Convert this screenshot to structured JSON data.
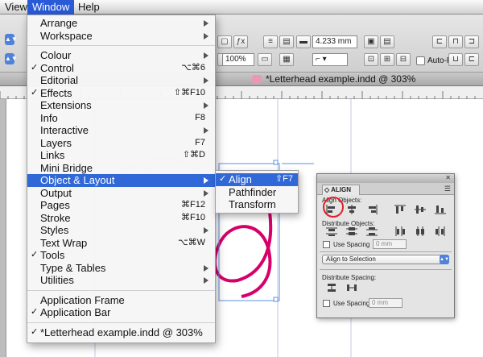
{
  "menubar": {
    "items": [
      {
        "label": "View",
        "active": false
      },
      {
        "label": "Window",
        "active": true
      },
      {
        "label": "Help",
        "active": false
      }
    ]
  },
  "control_bar": {
    "stroke_weight": "4.233 mm",
    "zoom": "100%",
    "autofit_label": "Auto-Fit"
  },
  "document": {
    "title": "*Letterhead example.indd @ 303%"
  },
  "window_menu": {
    "groups": [
      [
        {
          "label": "Arrange",
          "submenu": true
        },
        {
          "label": "Workspace",
          "submenu": true
        }
      ],
      [
        {
          "label": "Colour",
          "submenu": true
        },
        {
          "label": "Control",
          "checked": true,
          "shortcut": "⌥⌘6"
        },
        {
          "label": "Editorial",
          "submenu": true
        },
        {
          "label": "Effects",
          "checked": true,
          "shortcut": "⇧⌘F10"
        },
        {
          "label": "Extensions",
          "submenu": true
        },
        {
          "label": "Info",
          "shortcut": "F8"
        },
        {
          "label": "Interactive",
          "submenu": true
        },
        {
          "label": "Layers",
          "shortcut": "F7"
        },
        {
          "label": "Links",
          "shortcut": "⇧⌘D"
        },
        {
          "label": "Mini Bridge"
        },
        {
          "label": "Object & Layout",
          "submenu": true,
          "highlighted": true
        },
        {
          "label": "Output",
          "submenu": true
        },
        {
          "label": "Pages",
          "shortcut": "⌘F12"
        },
        {
          "label": "Stroke",
          "shortcut": "⌘F10"
        },
        {
          "label": "Styles",
          "submenu": true
        },
        {
          "label": "Text Wrap",
          "shortcut": "⌥⌘W"
        },
        {
          "label": "Tools",
          "checked": true
        },
        {
          "label": "Type & Tables",
          "submenu": true
        },
        {
          "label": "Utilities",
          "submenu": true
        }
      ],
      [
        {
          "label": "Application Frame"
        },
        {
          "label": "Application Bar",
          "checked": true
        }
      ],
      [
        {
          "label": "*Letterhead example.indd @ 303%",
          "checked": true
        }
      ]
    ]
  },
  "submenu": {
    "items": [
      {
        "label": "Align",
        "checked": true,
        "shortcut": "⇧F7",
        "highlighted": true
      },
      {
        "label": "Pathfinder"
      },
      {
        "label": "Transform"
      }
    ]
  },
  "align_panel": {
    "tab_label": "ALIGN",
    "close_glyph": "✕",
    "menu_glyph": "☰",
    "align_objects_label": "Align Objects:",
    "distribute_objects_label": "Distribute Objects:",
    "use_spacing_label": "Use Spacing",
    "spacing_value": "0 mm",
    "align_to_label": "Align to Selection",
    "distribute_spacing_label": "Distribute Spacing:",
    "use_spacing_label_2": "Use Spacing",
    "spacing_value_2": "0 mm"
  },
  "colors": {
    "accent": "#3168d8",
    "menubar_active": "#2a5ad7",
    "artwork_magenta": "#d6006a",
    "highlight_circle": "#e0202a"
  }
}
